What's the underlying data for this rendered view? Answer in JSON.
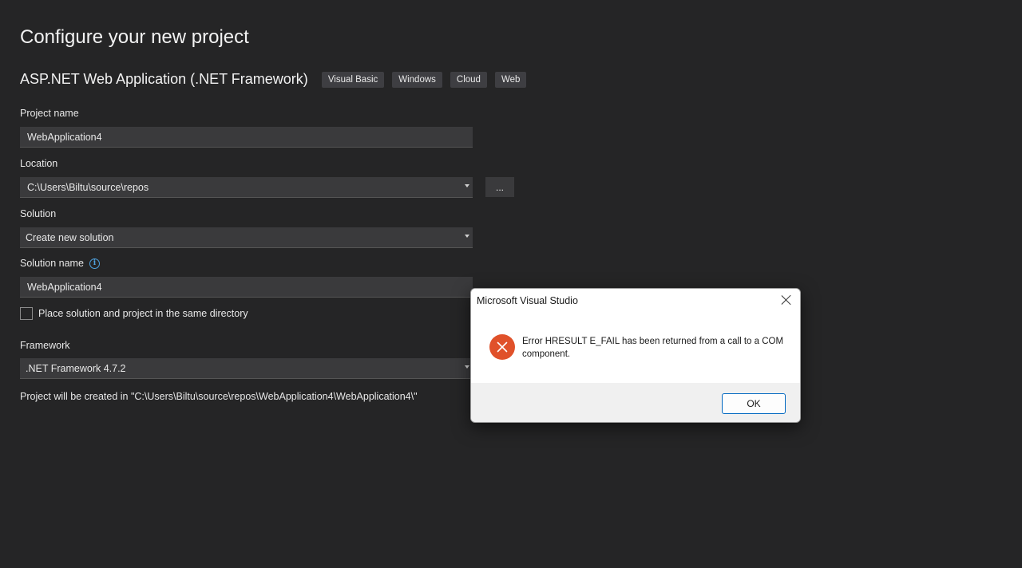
{
  "page": {
    "title": "Configure your new project",
    "template_name": "ASP.NET Web Application (.NET Framework)",
    "tags": [
      "Visual Basic",
      "Windows",
      "Cloud",
      "Web"
    ]
  },
  "form": {
    "project_name_label": "Project name",
    "project_name_value": "WebApplication4",
    "location_label": "Location",
    "location_value": "C:\\Users\\Biltu\\source\\repos",
    "browse_label": "...",
    "solution_label": "Solution",
    "solution_value": "Create new solution",
    "solution_name_label": "Solution name",
    "solution_name_value": "WebApplication4",
    "same_dir_label": "Place solution and project in the same directory",
    "framework_label": "Framework",
    "framework_value": ".NET Framework 4.7.2",
    "path_note": "Project will be created in \"C:\\Users\\Biltu\\source\\repos\\WebApplication4\\WebApplication4\\\""
  },
  "dialog": {
    "title": "Microsoft Visual Studio",
    "message": "Error HRESULT E_FAIL has been returned from a call to a COM component.",
    "ok_label": "OK"
  },
  "colors": {
    "background": "#252526",
    "field": "#3a3a3c",
    "error_icon": "#e0512a",
    "ok_border": "#0067c0",
    "info_icon": "#4fa3e0"
  }
}
